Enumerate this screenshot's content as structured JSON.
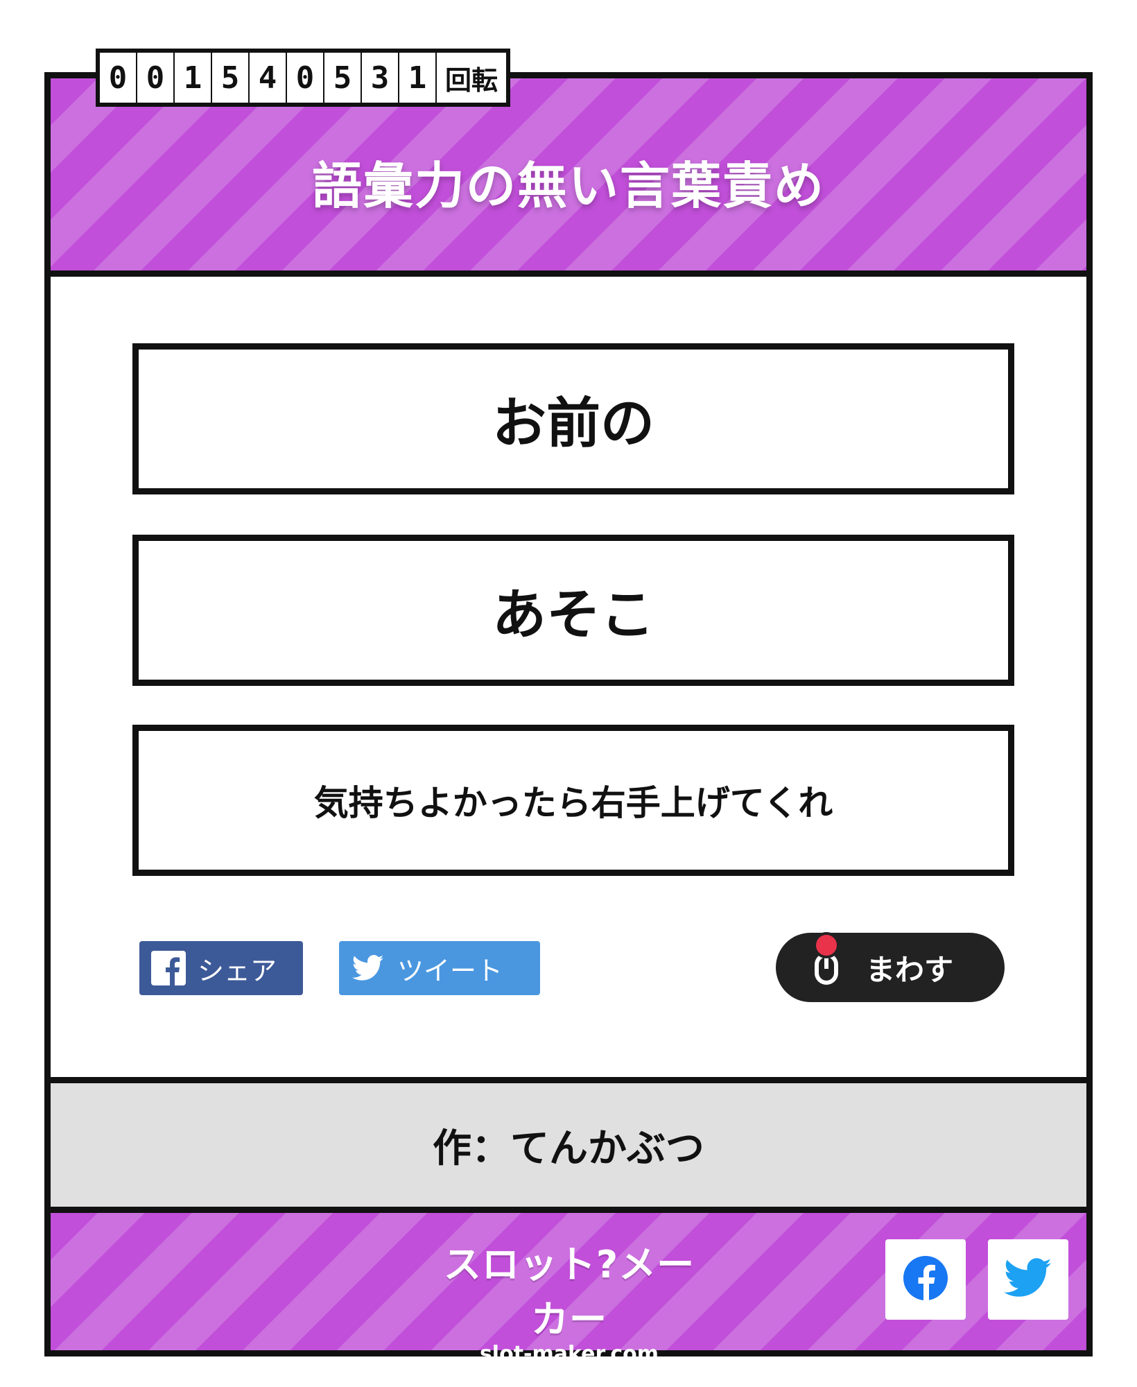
{
  "counter": {
    "digits": [
      "0",
      "0",
      "1",
      "5",
      "4",
      "0",
      "5",
      "3",
      "1"
    ],
    "unit": "回転"
  },
  "header": {
    "title": "語彙力の無い言葉責め"
  },
  "reels": [
    {
      "text": "お前の"
    },
    {
      "text": "あそこ"
    },
    {
      "text": "気持ちよかったら右手上げてくれ"
    }
  ],
  "actions": {
    "facebook_share_label": "シェア",
    "tweet_label": "ツイート",
    "spin_label": "まわす"
  },
  "author": {
    "label": "作：てんかぶつ"
  },
  "footer": {
    "logo_text": "スロット?メーカー",
    "logo_url": "slot-maker.com",
    "icons": [
      "facebook-icon",
      "twitter-icon"
    ]
  },
  "colors": {
    "brand_purple": "#c14fd9",
    "stripe_light": "#cc70e0",
    "facebook": "#3d5a98",
    "twitter": "#4a97e0",
    "spin_button": "#222222",
    "lever_red": "#e8334a"
  }
}
